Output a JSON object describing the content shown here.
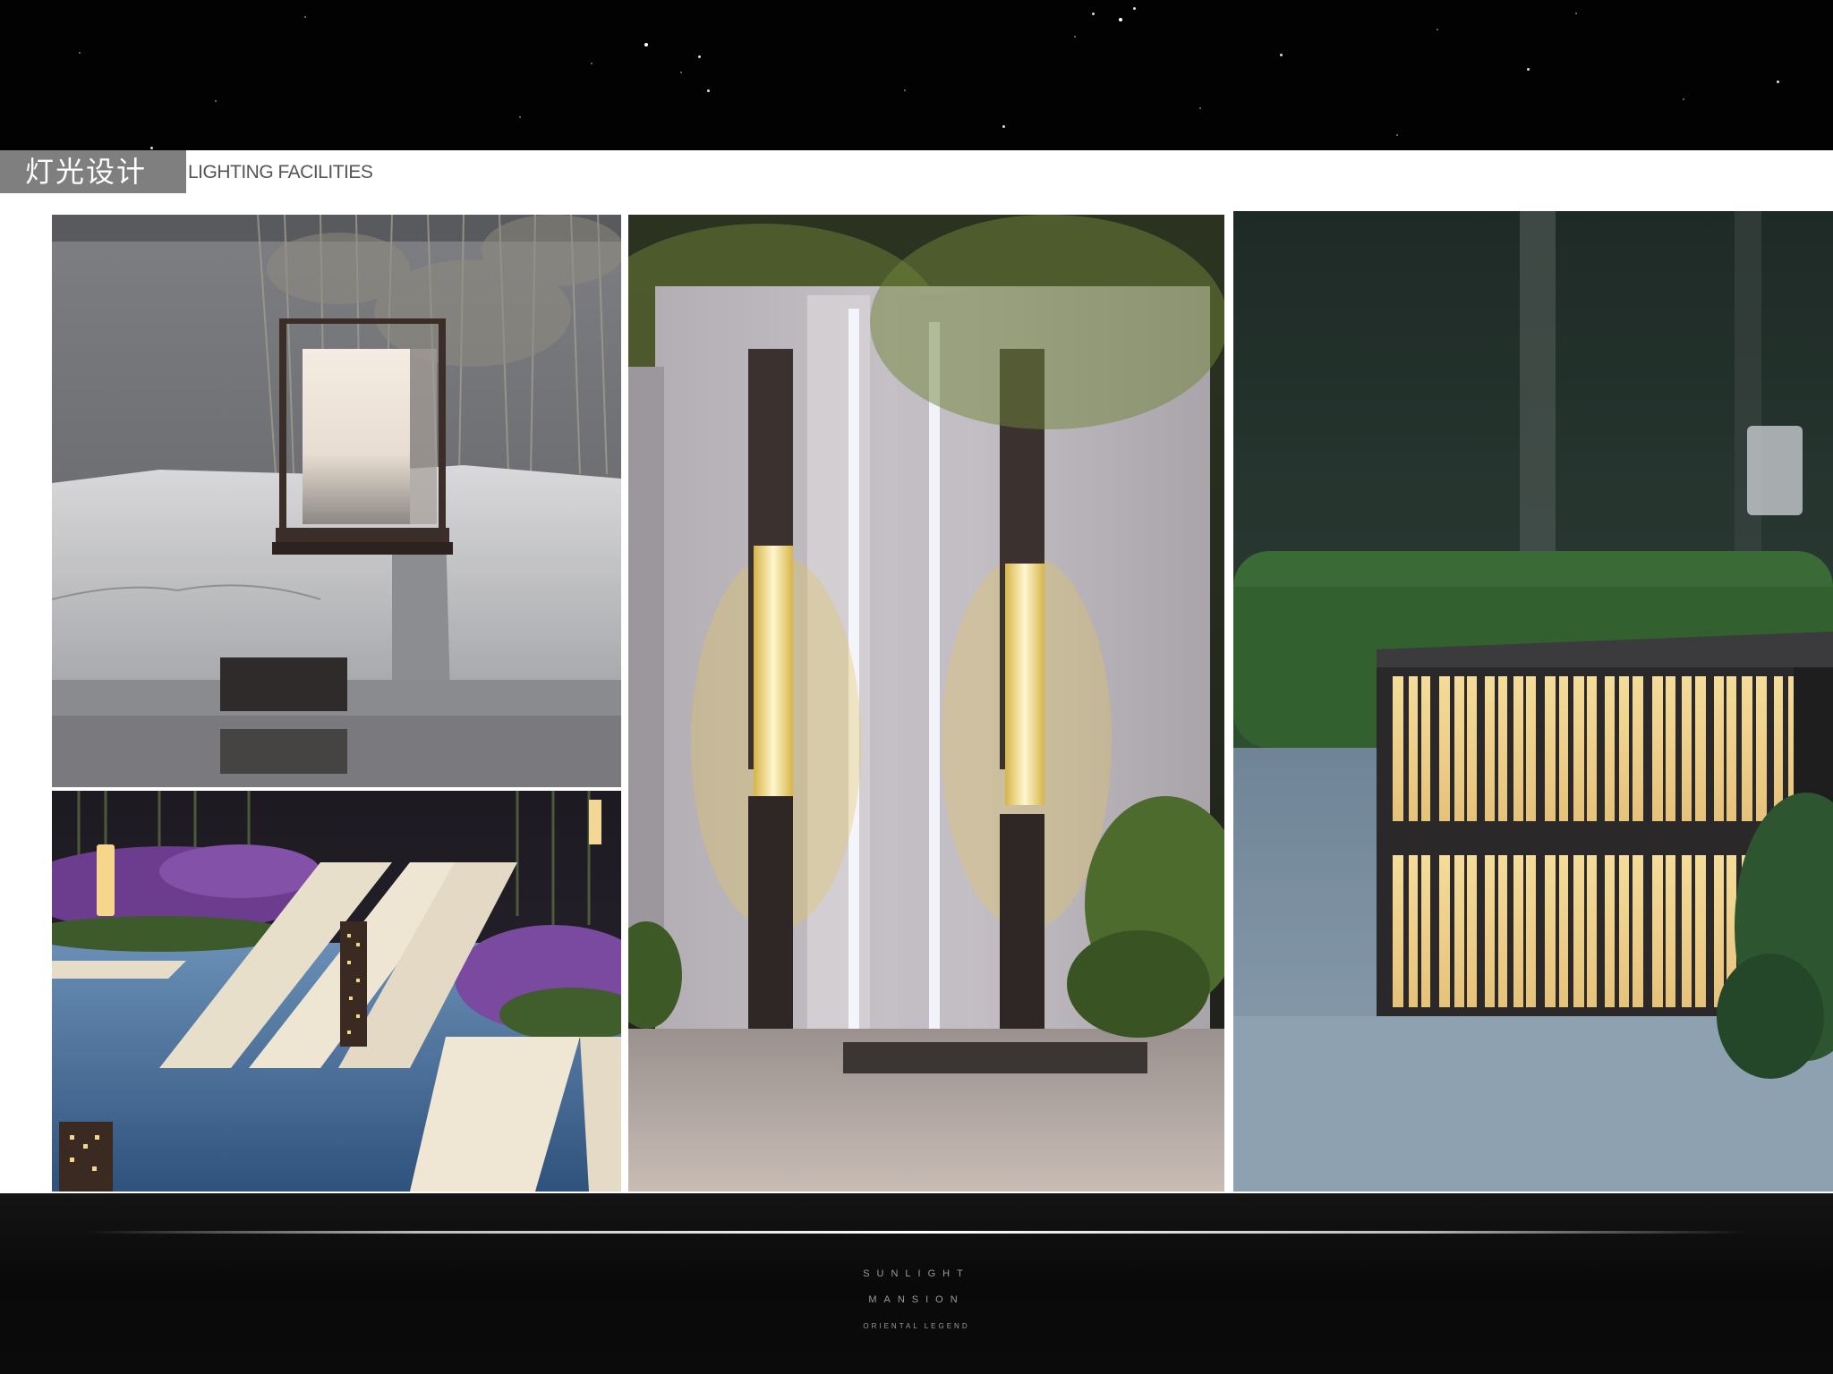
{
  "header": {
    "title_cn": "灯光设计",
    "title_en": "LIGHTING FACILITIES"
  },
  "footer": {
    "brand_line1": "SUNLIGHT",
    "brand_line2": "MANSION",
    "brand_line3": "ORIENTAL LEGEND"
  },
  "colors": {
    "page_background": "#000000",
    "content_background": "#ffffff",
    "title_box": "#7f7f7f",
    "title_en_text": "#555555",
    "footer_text": "#9a9a9a",
    "lamp_glow": "#f6dc8e"
  },
  "photos": [
    {
      "name": "photo-stone-lantern",
      "subject": "square lantern on granite stone by bamboo"
    },
    {
      "name": "photo-garden-path",
      "subject": "bollard lights along stepping-stone path with lavender"
    },
    {
      "name": "photo-wall-pillar-lights",
      "subject": "pillar lamps and LED strips on granite feature wall"
    },
    {
      "name": "photo-box-light",
      "subject": "slatted illuminated box light at dusk"
    }
  ]
}
